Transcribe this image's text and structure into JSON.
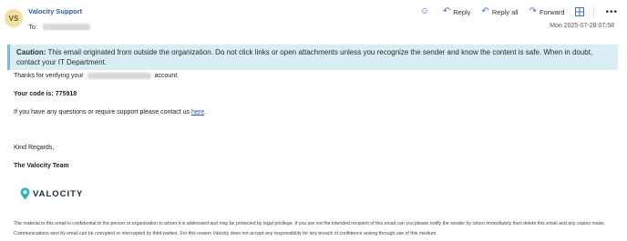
{
  "header": {
    "avatar_initials": "VS",
    "sender_name": "Valocity Support",
    "to_label": "To:",
    "date": "Mon 2025-07-28 07:58",
    "actions": {
      "reply_label": "Reply",
      "reply_all_label": "Reply all",
      "forward_label": "Forward"
    },
    "icons": {
      "emoji": "smiley-icon",
      "reply": "reply-icon",
      "reply_all": "reply-all-icon",
      "forward": "forward-icon",
      "grid": "grid-icon",
      "more": "more-icon"
    }
  },
  "caution": {
    "title": "Caution:",
    "text": "This email originated from outside the organization. Do not click links or open attachments unless you recognize the sender and know the content is safe. When in doubt, contact your IT Department."
  },
  "body": {
    "thanks_prefix": "Thanks for verifying your",
    "thanks_suffix": "account.",
    "code_line": "Your code is: 775918",
    "help_prefix": "If you have any questions or require support please contact us",
    "help_link": "here",
    "help_suffix": ".",
    "regards": "Kind Regards,",
    "team": "The Valocity Team"
  },
  "logo": {
    "text": "VALOCITY",
    "color": "#2bb3c0"
  },
  "disclaimer": "The material in this email is confidential to the person or organisation to whom it is addressed and may be protected by legal privilege. If you are not the intended recipient of this email can you please notify the sender by return immediately then delete this email and any copies made. Communications sent by email can be corrupted or intercepted by third parties. For this reason Valocity does not accept any responsibility for any breach of confidence arising through use of this medium."
}
